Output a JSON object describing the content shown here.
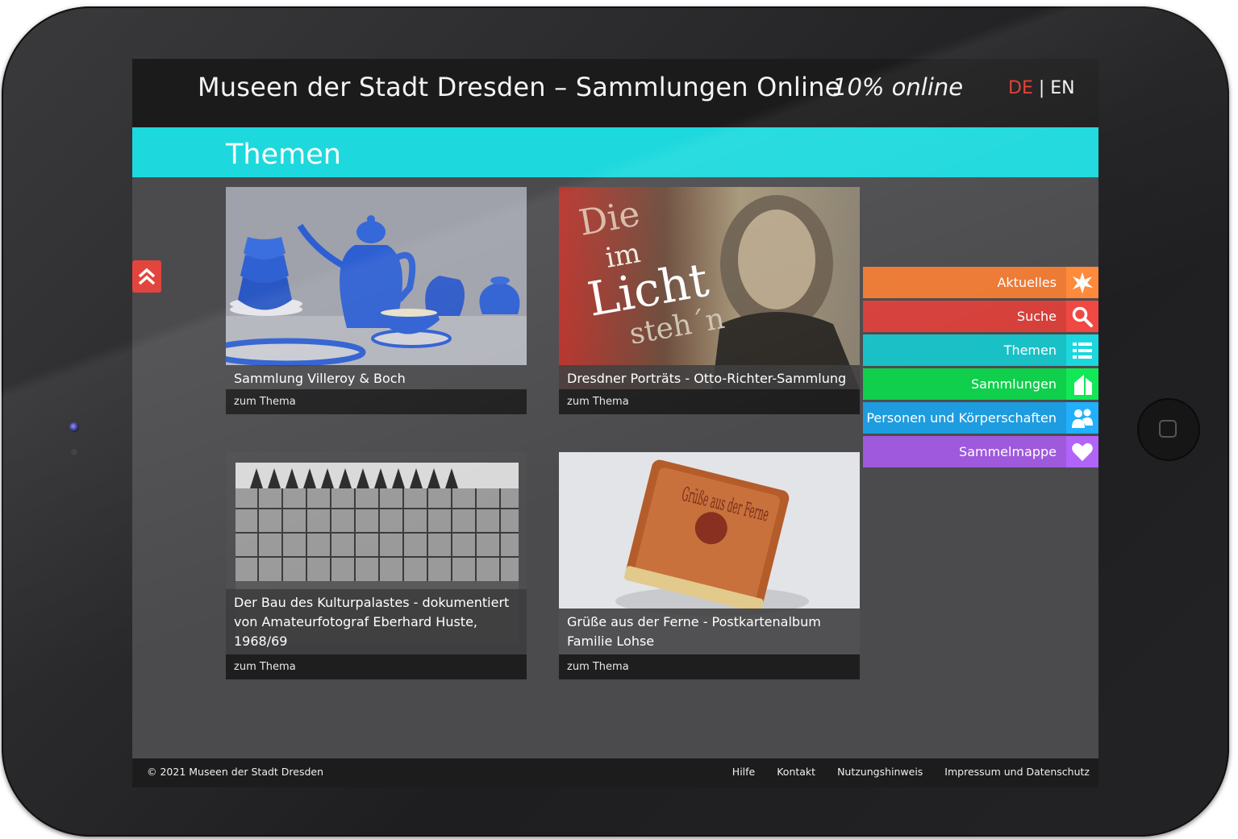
{
  "header": {
    "title": "Museen der Stadt Dresden – Sammlungen Online",
    "online": "10% online",
    "lang_de": "DE",
    "lang_sep": " | ",
    "lang_en": "EN"
  },
  "banner": {
    "title": "Themen"
  },
  "cards": [
    {
      "title": "Sammlung Villeroy & Boch",
      "link": "zum Thema"
    },
    {
      "title": "Dresdner Porträts - Otto-Richter-Sammlung",
      "link": "zum Thema"
    },
    {
      "title": "Der Bau des Kulturpalastes - dokumentiert von Amateurfotograf Eberhard Huste, 1968/69",
      "link": "zum Thema"
    },
    {
      "title": "Grüße aus der Ferne - Postkartenalbum Familie Lohse",
      "link": "zum Thema"
    }
  ],
  "card_images": {
    "poster_text_1": "Die",
    "poster_text_2": "im",
    "poster_text_3": "Licht",
    "poster_text_4": "steh´n",
    "book_text": "Grüße aus der Ferne"
  },
  "menu": [
    {
      "label": "Aktuelles",
      "color": "#ec7a34",
      "icon": "star-burst-icon"
    },
    {
      "label": "Suche",
      "color": "#d6403b",
      "icon": "search-icon"
    },
    {
      "label": "Themen",
      "color": "#19c0c6",
      "icon": "list-icon"
    },
    {
      "label": "Sammlungen",
      "color": "#10cf4c",
      "icon": "house-icon"
    },
    {
      "label": "Personen und Körperschaften",
      "color": "#1e9ce0",
      "icon": "people-icon"
    },
    {
      "label": "Sammelmappe",
      "color": "#9e59dd",
      "icon": "heart-icon"
    }
  ],
  "footer": {
    "copyright": "© 2021 Museen der Stadt Dresden",
    "links": [
      "Hilfe",
      "Kontakt",
      "Nutzungshinweis",
      "Impressum und Datenschutz"
    ]
  }
}
